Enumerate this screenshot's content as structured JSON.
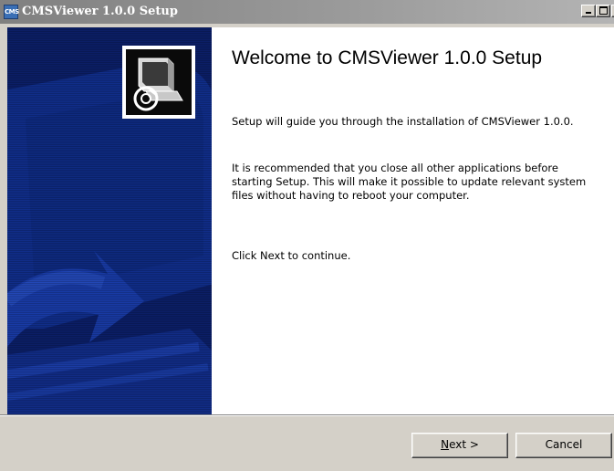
{
  "window": {
    "title": "CMSViewer 1.0.0 Setup",
    "icon": "cms-app-icon",
    "icon_text": "CMS",
    "controls": {
      "minimize": "_",
      "maximize": "□",
      "close": "×"
    }
  },
  "sidebar": {
    "background_color": "#0a1f6b",
    "logo": "installer-computer-icon"
  },
  "content": {
    "title": "Welcome to CMSViewer 1.0.0 Setup",
    "paragraphs": [
      "Setup will guide you through the installation of CMSViewer 1.0.0.",
      "It is recommended that you close all other applications before starting Setup. This will make it possible to update relevant system files without having to reboot your computer.",
      "Click Next to continue."
    ]
  },
  "buttons": {
    "next_mnemonic": "N",
    "next_rest": "ext >",
    "cancel": "Cancel"
  }
}
